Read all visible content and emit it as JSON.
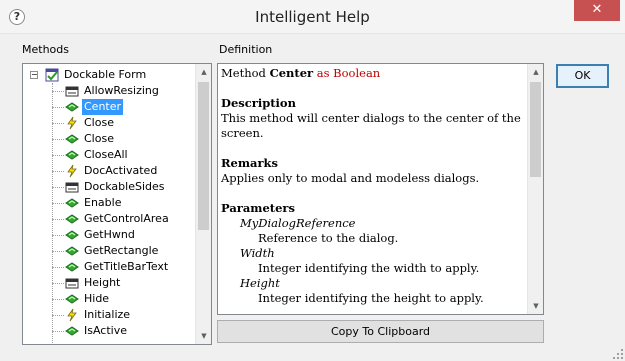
{
  "window": {
    "title": "Intelligent Help",
    "help_glyph": "?",
    "close_glyph": "✕"
  },
  "labels": {
    "methods": "Methods",
    "definition": "Definition"
  },
  "tree": {
    "root": "Dockable Form",
    "items": [
      {
        "label": "AllowResizing",
        "icon": "property-icon"
      },
      {
        "label": "Center",
        "icon": "method-icon",
        "selected": true
      },
      {
        "label": "Close",
        "icon": "event-icon"
      },
      {
        "label": "Close",
        "icon": "method-icon"
      },
      {
        "label": "CloseAll",
        "icon": "method-icon"
      },
      {
        "label": "DocActivated",
        "icon": "event-icon"
      },
      {
        "label": "DockableSides",
        "icon": "property-icon"
      },
      {
        "label": "Enable",
        "icon": "method-icon"
      },
      {
        "label": "GetControlArea",
        "icon": "method-icon"
      },
      {
        "label": "GetHwnd",
        "icon": "method-icon"
      },
      {
        "label": "GetRectangle",
        "icon": "method-icon"
      },
      {
        "label": "GetTitleBarText",
        "icon": "method-icon"
      },
      {
        "label": "Height",
        "icon": "property-icon"
      },
      {
        "label": "Hide",
        "icon": "method-icon"
      },
      {
        "label": "Initialize",
        "icon": "event-icon"
      },
      {
        "label": "IsActive",
        "icon": "method-icon"
      }
    ]
  },
  "definition": {
    "heading_prefix": "Method",
    "method_name": "Center",
    "return_type": "as Boolean",
    "description_title": "Description",
    "description": "This method will center dialogs to the center of the screen.",
    "remarks_title": "Remarks",
    "remarks": "Applies only to modal and modeless dialogs.",
    "parameters_title": "Parameters",
    "parameters": [
      {
        "name": "MyDialogReference",
        "desc": "Reference to the dialog."
      },
      {
        "name": "Width",
        "desc": "Integer identifying the width to apply."
      },
      {
        "name": "Height",
        "desc": "Integer identifying the height to apply."
      }
    ]
  },
  "buttons": {
    "ok": "OK",
    "copy": "Copy To Clipboard"
  },
  "colors": {
    "selection": "#3399ff",
    "return_type": "#c00000",
    "close_button": "#c75050"
  }
}
